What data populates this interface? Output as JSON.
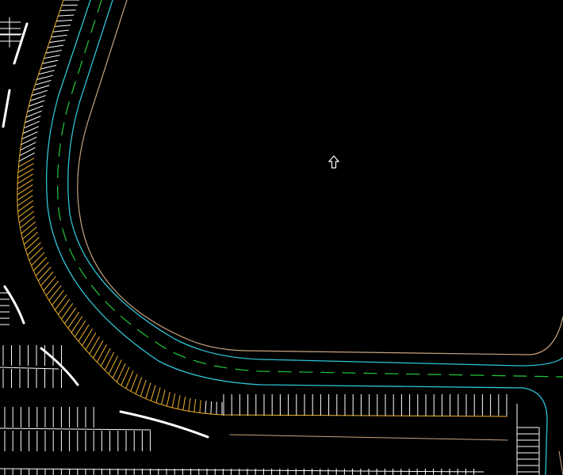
{
  "drawing": {
    "background": "#000000",
    "layers": [
      {
        "name": "road-outer-edge",
        "color": "#c8a37e"
      },
      {
        "name": "curb-line",
        "color": "#2ec4d6"
      },
      {
        "name": "lane-centerline",
        "color": "#22c93a"
      },
      {
        "name": "parking-stalls",
        "color": "#ffffff"
      },
      {
        "name": "parking-stalls-highlighted",
        "color": "#f0b429"
      }
    ]
  },
  "cursor": {
    "icon": "up-arrow-cursor-icon"
  }
}
